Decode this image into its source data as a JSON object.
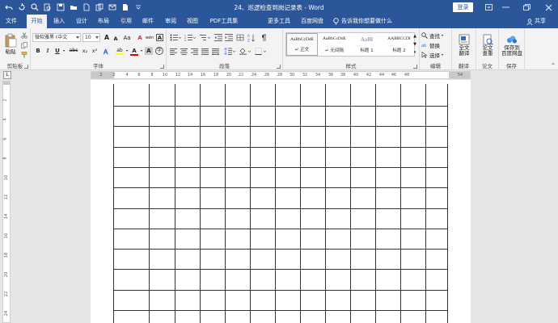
{
  "window": {
    "title": "24、巡逻检查到岗记录表 - Word",
    "login_label": "登录",
    "tell_me": "告诉我你想要做什么",
    "share_label": "共享"
  },
  "tabs": [
    {
      "label": "文件",
      "active": false
    },
    {
      "label": "开始",
      "active": true
    },
    {
      "label": "插入",
      "active": false
    },
    {
      "label": "设计",
      "active": false
    },
    {
      "label": "布局",
      "active": false
    },
    {
      "label": "引用",
      "active": false
    },
    {
      "label": "邮件",
      "active": false
    },
    {
      "label": "审阅",
      "active": false
    },
    {
      "label": "视图",
      "active": false
    },
    {
      "label": "PDF工具集",
      "active": false
    },
    {
      "label": "更多工具",
      "active": false
    },
    {
      "label": "百度网盘",
      "active": false
    }
  ],
  "ribbon": {
    "clipboard": {
      "label": "剪贴板",
      "paste_label": "粘贴"
    },
    "font": {
      "label": "字体",
      "font_name": "微软雅黑 (中文",
      "font_size": "10",
      "bold": "B",
      "italic": "I",
      "underline": "U",
      "strike": "abc",
      "sub": "x₂",
      "sup": "x²",
      "change_case": "Aa",
      "grow": "A",
      "shrink": "A",
      "clear": "A",
      "phonetic": "wén",
      "border_char": "A",
      "highlight": "ab",
      "font_color": "A",
      "shade": "A",
      "enclose": "字"
    },
    "paragraph": {
      "label": "段落"
    },
    "styles": {
      "label": "样式",
      "items": [
        {
          "preview": "AaBbCcDdE",
          "name": "↵ 正文"
        },
        {
          "preview": "AaBbCcDdE",
          "name": "↵ 无间隔"
        },
        {
          "preview": "AaBl",
          "name": "标题 1"
        },
        {
          "preview": "AABBCCDI",
          "name": "标题 2"
        }
      ]
    },
    "editing": {
      "label": "编辑",
      "find": "查找",
      "replace": "替换",
      "select": "选择"
    },
    "translate": {
      "label": "翻译",
      "btn": [
        "全文",
        "翻译"
      ]
    },
    "paper": {
      "label": "论文",
      "btn": [
        "论文",
        "查重"
      ]
    },
    "save": {
      "label": "保存",
      "btn": [
        "保存到",
        "百度网盘"
      ]
    }
  },
  "ruler": {
    "corner": "L",
    "ticks": [
      "2",
      "2",
      "4",
      "6",
      "8",
      "10",
      "12",
      "14",
      "16",
      "18",
      "20",
      "22",
      "24",
      "26",
      "28",
      "30",
      "32",
      "34",
      "36",
      "38",
      "40",
      "42",
      "44",
      "46",
      "48",
      "54"
    ],
    "vticks": [
      "2",
      "4",
      "6",
      "8",
      "10",
      "12",
      "14",
      "16",
      "18",
      "20",
      "22",
      "24"
    ]
  },
  "colors": {
    "accent": "#2b579a",
    "highlight": "#ffff00",
    "font_red": "#e00000"
  }
}
